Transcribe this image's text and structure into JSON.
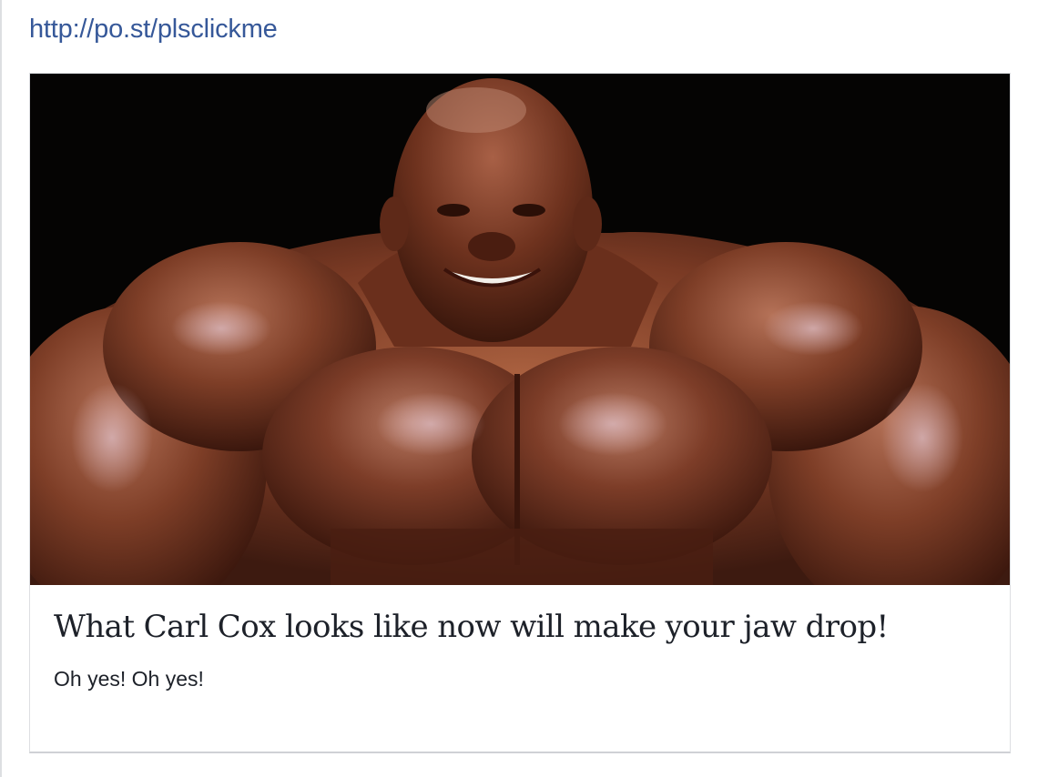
{
  "post": {
    "link_text": "http://po.st/plsclickme",
    "card": {
      "title": "What Carl Cox looks like now will make your jaw drop!",
      "description": "Oh yes! Oh yes!"
    }
  },
  "colors": {
    "link": "#365899",
    "text": "#1d2129",
    "border": "#dddfe2",
    "photo_background": "#050403",
    "skin": "#7a3a24"
  }
}
